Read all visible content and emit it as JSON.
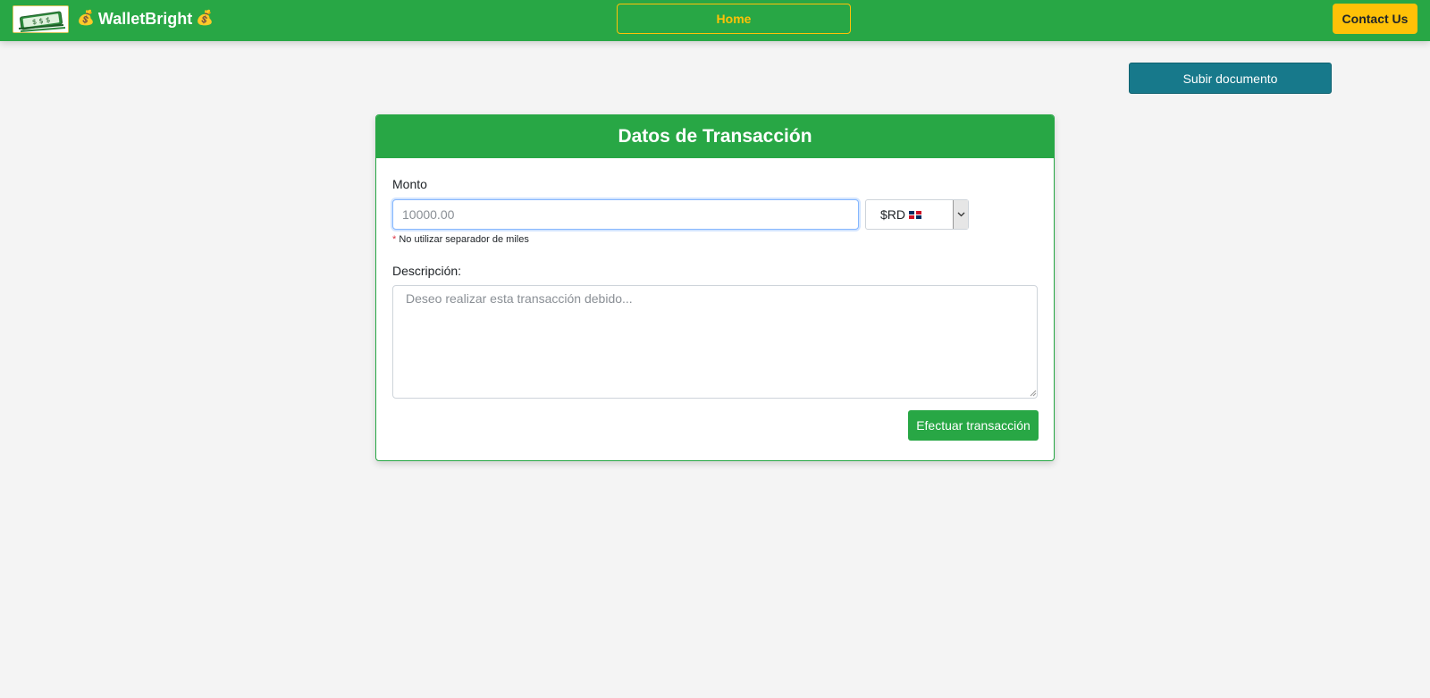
{
  "navbar": {
    "brand": "WalletBright",
    "brand_icon": "money-bag-icon",
    "home_label": "Home",
    "contact_label": "Contact Us",
    "colors": {
      "bar": "#28a745",
      "accent": "#ffc107"
    }
  },
  "actions": {
    "upload_label": "Subir documento",
    "upload_color": "#17798b"
  },
  "card": {
    "title": "Datos de Transacción",
    "amount_label": "Monto",
    "amount_placeholder": "10000.00",
    "currency_value": "$RD",
    "currency_flag": "dominican-republic-flag",
    "hint_star": "*",
    "hint_text": "No utilizar separador de miles",
    "description_label": "Descripción:",
    "description_placeholder": "Deseo realizar esta transacción debido...",
    "submit_label": "Efectuar transacción"
  }
}
